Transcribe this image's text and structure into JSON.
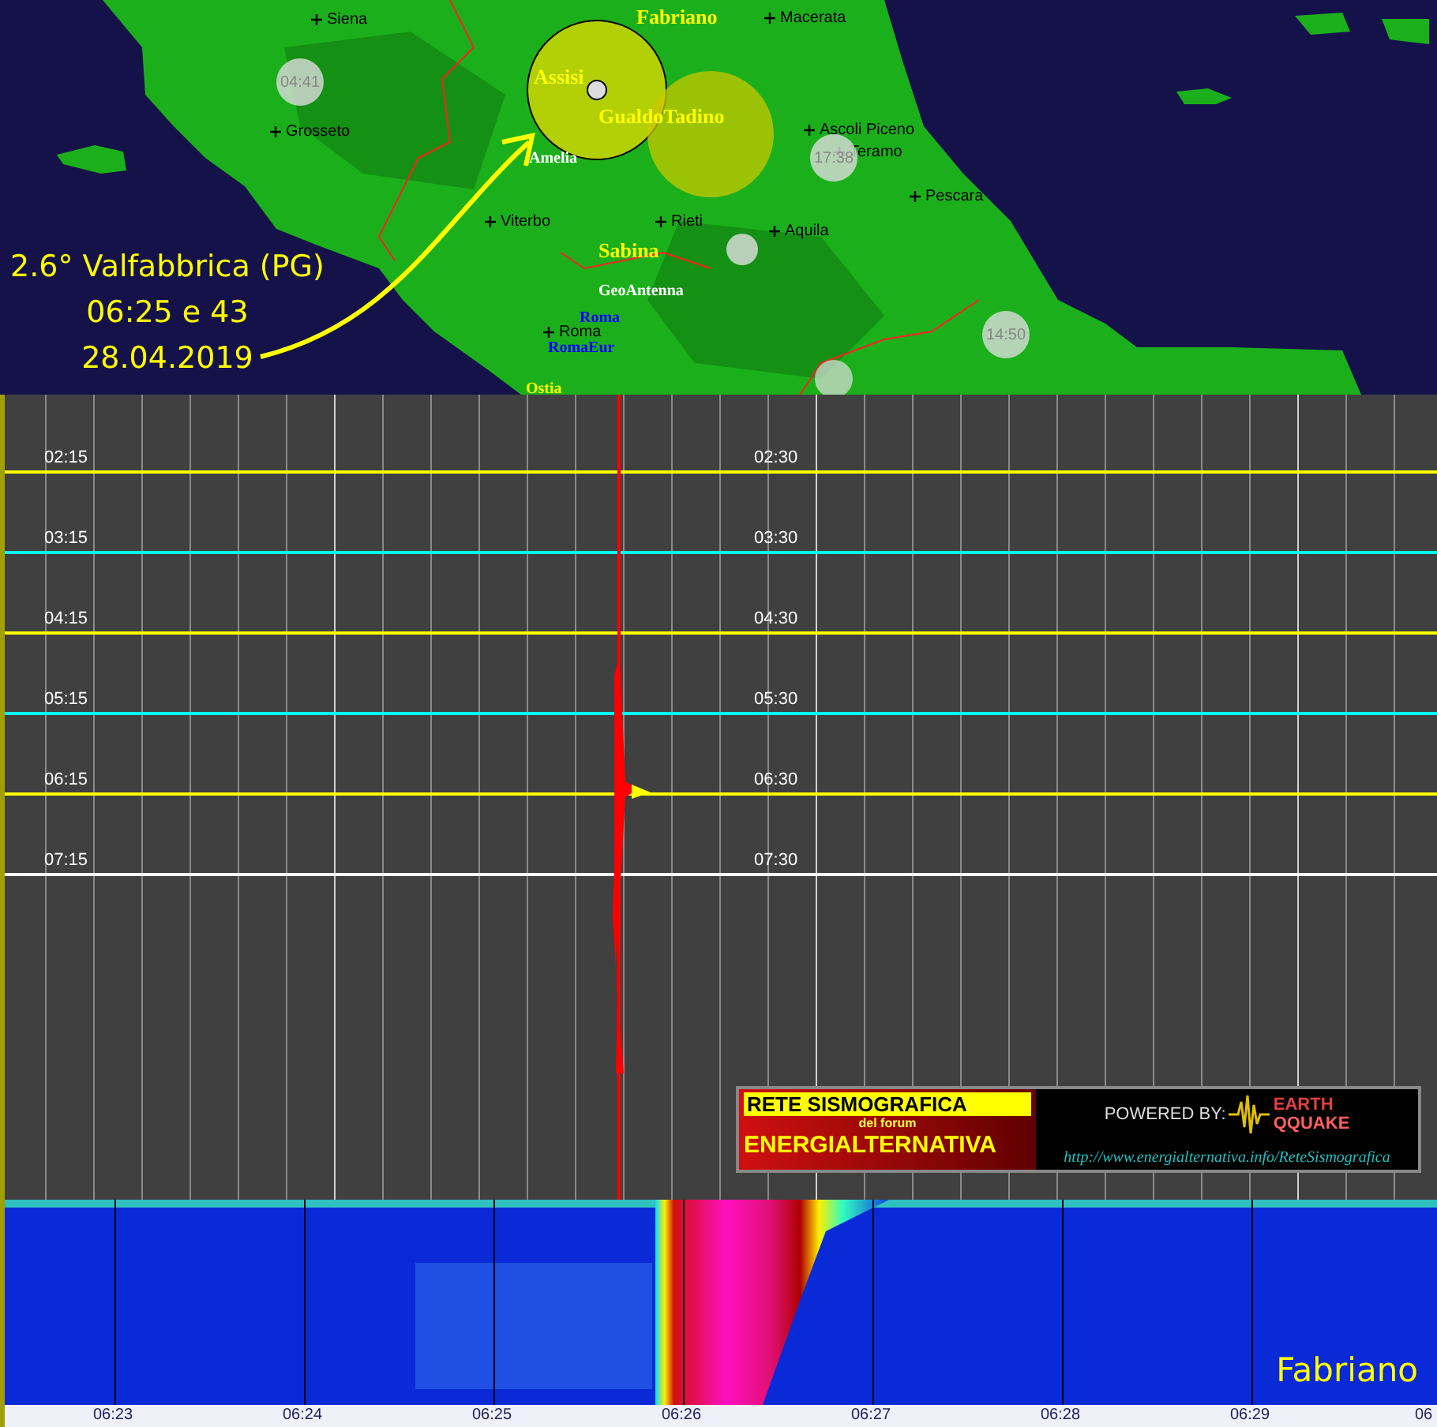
{
  "map": {
    "caption": [
      "2.6° Valfabbrica (PG)",
      "06:25 e 43",
      "28.04.2019"
    ],
    "places": [
      {
        "name": "Siena"
      },
      {
        "name": "Macerata"
      },
      {
        "name": "Grosseto"
      },
      {
        "name": "Ascoli Piceno"
      },
      {
        "name": "Teramo"
      },
      {
        "name": "Pescara"
      },
      {
        "name": "Viterbo"
      },
      {
        "name": "Rieti"
      },
      {
        "name": "Aquila"
      },
      {
        "name": "Roma"
      }
    ],
    "stations": [
      {
        "name": "Fabriano",
        "color": "#ffff00"
      },
      {
        "name": "Assisi",
        "color": "#ffff00"
      },
      {
        "name": "GualdoTadino",
        "color": "#ffff00"
      },
      {
        "name": "Amelia",
        "color": "#ffffff"
      },
      {
        "name": "Sabina",
        "color": "#ffff00"
      },
      {
        "name": "GeoAntenna",
        "color": "#ffffff"
      },
      {
        "name": "Roma",
        "color": "#0000ff"
      },
      {
        "name": "RomaEur",
        "color": "#0000ff"
      },
      {
        "name": "Ostia",
        "color": "#ffff00"
      }
    ],
    "quakes": [
      {
        "time": "04:41"
      },
      {
        "time": "17:38"
      },
      {
        "time": "14:50"
      }
    ]
  },
  "seismogram": {
    "rows": [
      {
        "start": "02:15",
        "mid": "02:30",
        "color": "#ffff00"
      },
      {
        "start": "03:15",
        "mid": "03:30",
        "color": "#00ffff"
      },
      {
        "start": "04:15",
        "mid": "04:30",
        "color": "#ffff00"
      },
      {
        "start": "05:15",
        "mid": "05:30",
        "color": "#00ffff"
      },
      {
        "start": "06:15",
        "mid": "06:30",
        "color": "#ffff00"
      },
      {
        "start": "07:15",
        "mid": "07:30",
        "color": "#ffffff"
      }
    ]
  },
  "banner": {
    "title": "RETE SISMOGRAFICA",
    "subtitle": "del forum",
    "name": "ENERGIALTERNATIVA",
    "powered": "POWERED BY:",
    "brand_top": "EARTH",
    "brand_bottom": "QQUAKE",
    "url": "http://www.energialternativa.info/ReteSismografica"
  },
  "spectrogram": {
    "station": "Fabriano",
    "ticks": [
      "06:23",
      "06:24",
      "06:25",
      "06:26",
      "06:27",
      "06:28",
      "06:29",
      "06"
    ]
  }
}
